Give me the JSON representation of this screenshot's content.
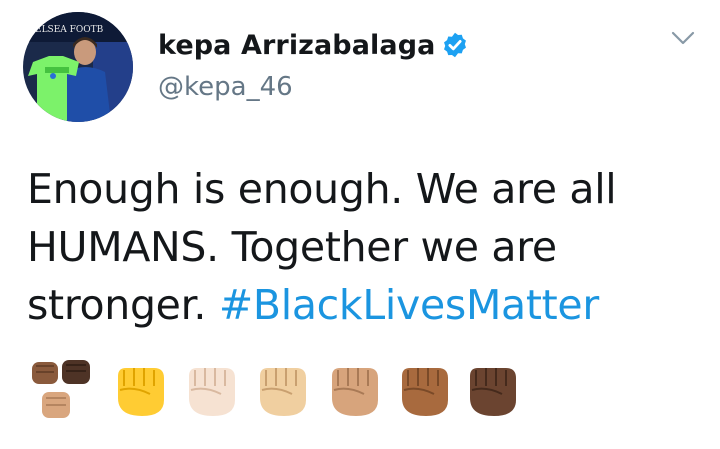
{
  "author": {
    "display_name": "kepa Arrizabalaga",
    "handle": "@kepa_46",
    "verified": true,
    "avatar_caption": "ELSEA FOOTB"
  },
  "tweet": {
    "line1": "Enough is enough. We are all",
    "line2": "HUMANS. Together we are",
    "line3_text": "stronger.",
    "hashtag": "#BlackLivesMatter",
    "emojis": [
      "family-fists-icon",
      "raised-fist-yellow-icon",
      "raised-fist-light-icon",
      "raised-fist-medium-light-icon",
      "raised-fist-medium-icon",
      "raised-fist-medium-dark-icon",
      "raised-fist-dark-icon"
    ]
  },
  "colors": {
    "text": "#14171a",
    "secondary": "#657786",
    "link": "#1b95e0",
    "verified_badge": "#1da1f2"
  },
  "icons": {
    "verified": "verified-badge-icon",
    "menu": "chevron-down-icon"
  }
}
